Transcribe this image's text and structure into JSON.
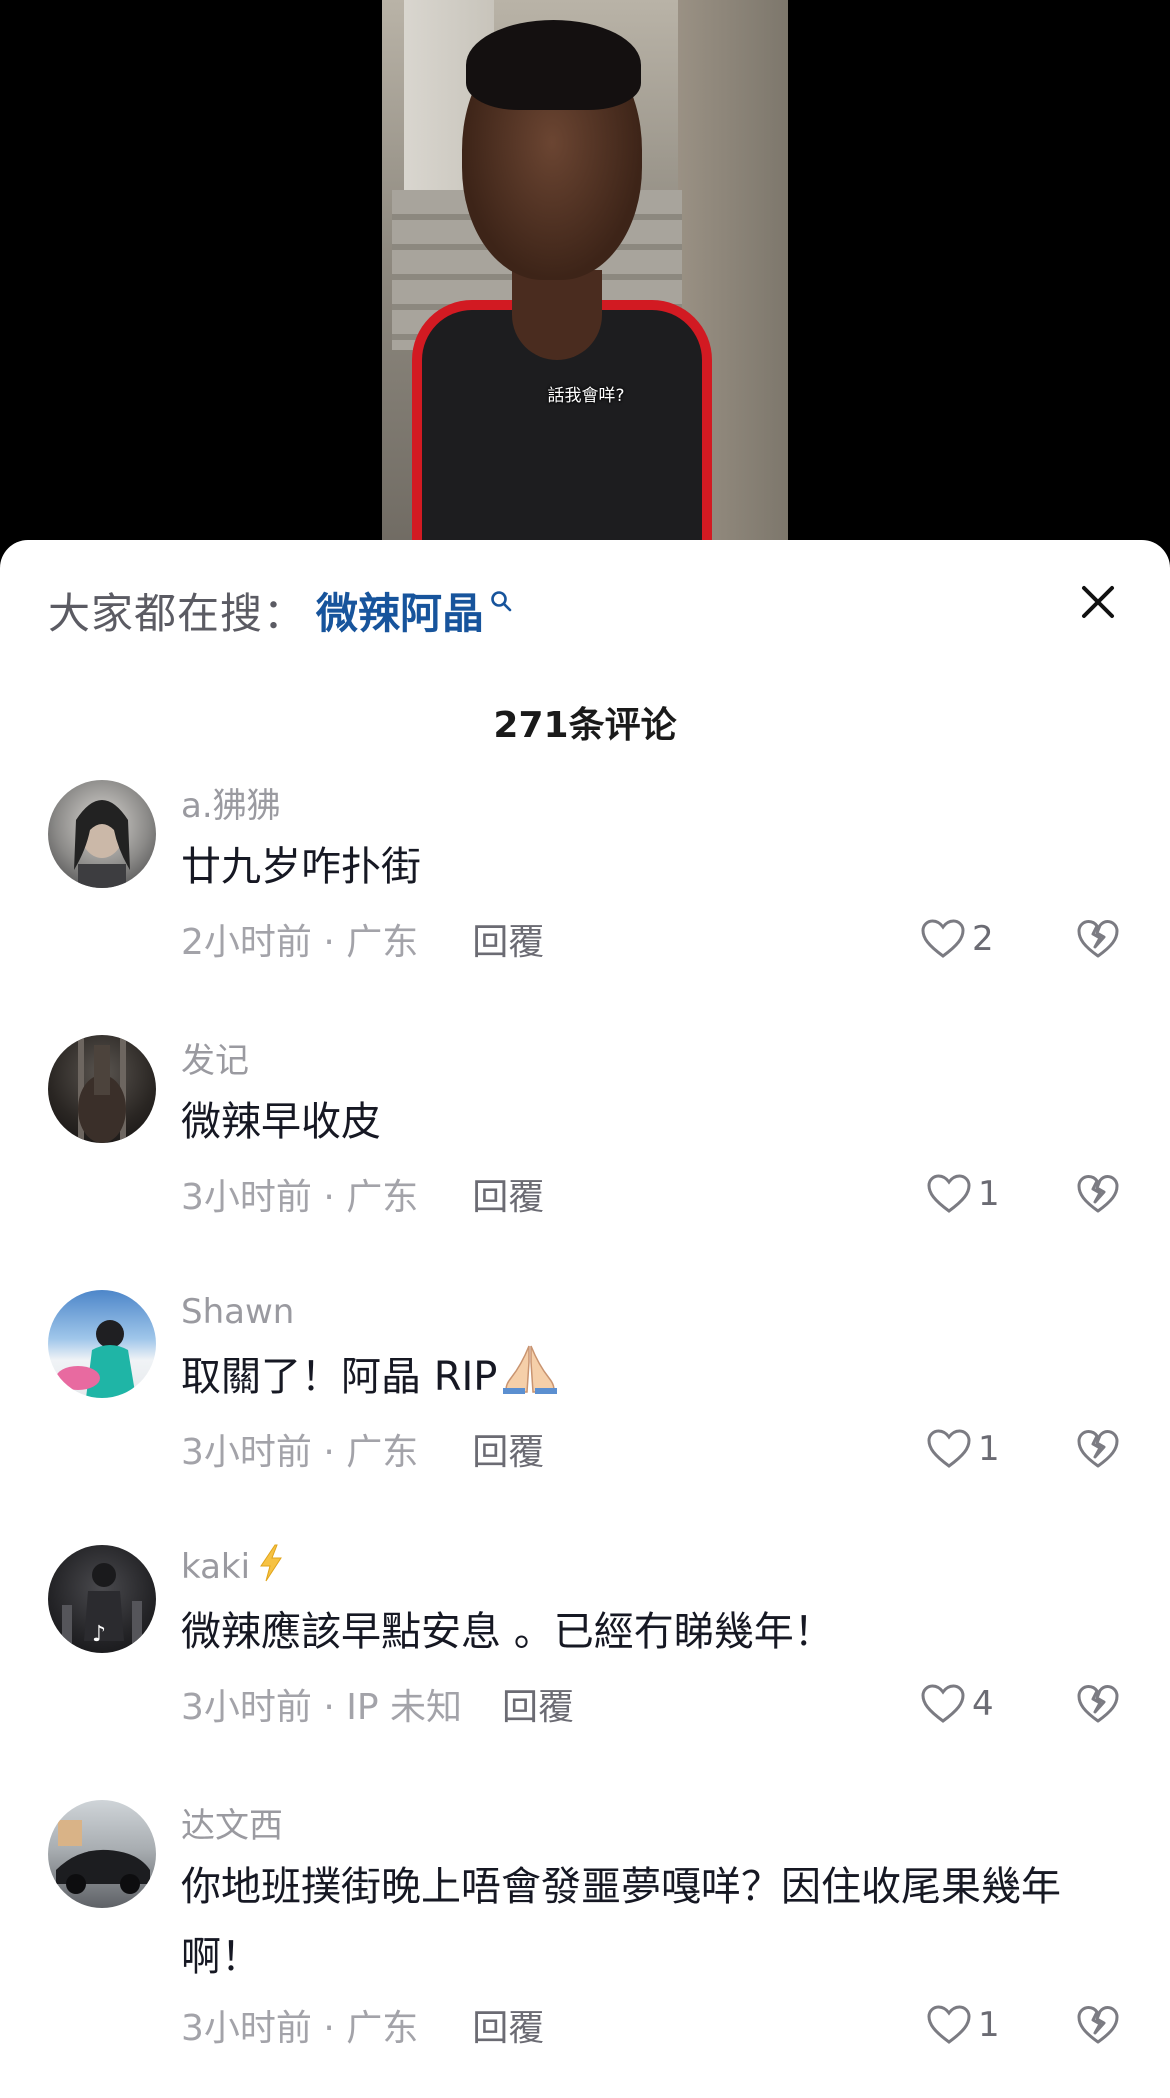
{
  "video": {
    "subtitle": "話我會咩?"
  },
  "search": {
    "prefix": "大家都在搜：",
    "term": "微辣阿晶"
  },
  "comments_header": {
    "count_label": "271条评论"
  },
  "comments": [
    {
      "username": "a.狒狒",
      "text": "廿九岁咋扑街",
      "meta": "2小时前 · 广东",
      "reply_label": "回覆",
      "likes": "2"
    },
    {
      "username": "发记",
      "text": "微辣早收皮",
      "meta": "3小时前 · 广东",
      "reply_label": "回覆",
      "likes": "1"
    },
    {
      "username": "Shawn",
      "text": "取關了！阿晶 RIP",
      "meta": "3小时前 · 广东",
      "reply_label": "回覆",
      "likes": "1"
    },
    {
      "username": "kaki",
      "text": "微辣應該早點安息 。已經冇睇幾年！",
      "meta": "3小时前 · IP 未知",
      "reply_label": "回覆",
      "likes": "4"
    },
    {
      "username": "达文西",
      "text": "你地班撲街晚上唔會發噩夢嘎咩？因住收尾果幾年啊！",
      "meta": "3小时前 · 广东",
      "reply_label": "回覆",
      "likes": "1"
    }
  ],
  "colors": {
    "search_term": "#17549c",
    "sheet_bg": "#ffffff",
    "meta_gray": "#a3a3a9",
    "text_dark": "#161823"
  },
  "icons": {
    "close": "close-icon",
    "like": "heart-outline-icon",
    "dislike": "broken-heart-icon",
    "search_hint": "search-icon",
    "lightning": "lightning-icon"
  }
}
